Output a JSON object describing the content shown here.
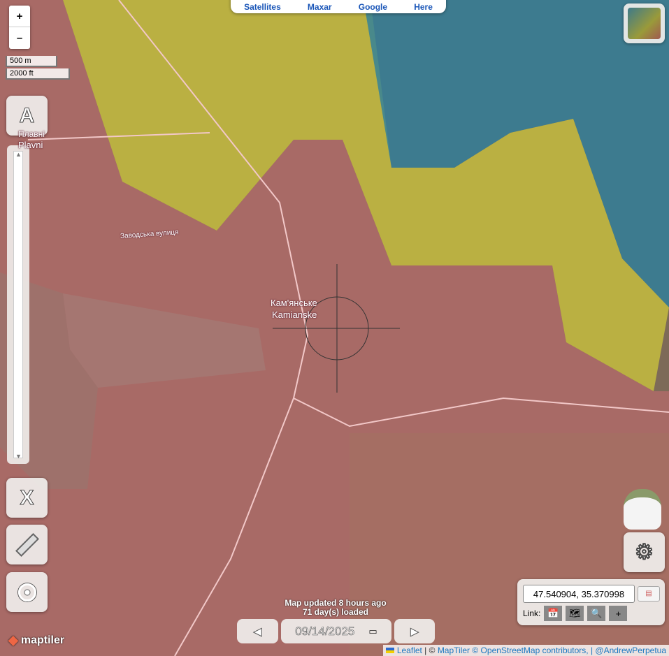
{
  "top_sources": [
    "Satellites",
    "Maxar",
    "Google",
    "Here"
  ],
  "zoom": {
    "in": "+",
    "out": "–"
  },
  "scale": {
    "metric": "500 m",
    "imperial": "2000 ft"
  },
  "buttons": {
    "labels_toggle": "A",
    "close": "X"
  },
  "map_labels": {
    "town_uk": "Кам'янське",
    "town_en": "Kamianske",
    "village_uk": "Плавні",
    "village_en": "Plavni",
    "street": "Заводська вулиця"
  },
  "status": {
    "updated": "Map updated 8 hours ago",
    "loaded": "71 day(s) loaded"
  },
  "date": {
    "value": "09/14/2025",
    "prev": "◀",
    "next": "▶"
  },
  "coords": {
    "value": "47.540904, 35.370998",
    "link_label": "Link:"
  },
  "attribution": {
    "leaflet": "Leaflet",
    "sep1": " | © ",
    "maptiler": "MapTiler",
    "osm": " © OpenStreetMap contributors, | ",
    "author": "@AndrewPerpetua"
  },
  "logo": "maptiler",
  "colors": {
    "occupied": "#b56a6a",
    "contested": "#c8c040",
    "liberated": "#2a7aa0"
  }
}
